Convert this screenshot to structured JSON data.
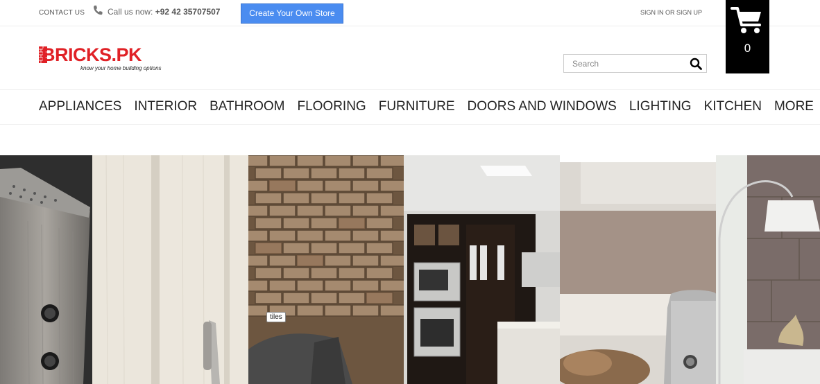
{
  "topbar": {
    "contact_label": "CONTACT US",
    "call_prefix": "Call us now: ",
    "phone_number": "+92 42 35707507",
    "create_store_label": "Create Your Own Store",
    "signin_label": "SIGN IN OR SIGN UP"
  },
  "cart": {
    "count": "0"
  },
  "logo": {
    "name": "BRICKS.PK",
    "tagline": "know your home building options"
  },
  "search": {
    "placeholder": "Search"
  },
  "nav": {
    "items": [
      "APPLIANCES",
      "INTERIOR",
      "BATHROOM",
      "FLOORING",
      "FURNITURE",
      "DOORS AND WINDOWS",
      "LIGHTING",
      "KITCHEN",
      "MORE"
    ]
  },
  "hero": {
    "tooltip": "tiles"
  },
  "colors": {
    "brand_red": "#e02126",
    "button_blue": "#4a8cf0",
    "cart_bg": "#000000"
  }
}
